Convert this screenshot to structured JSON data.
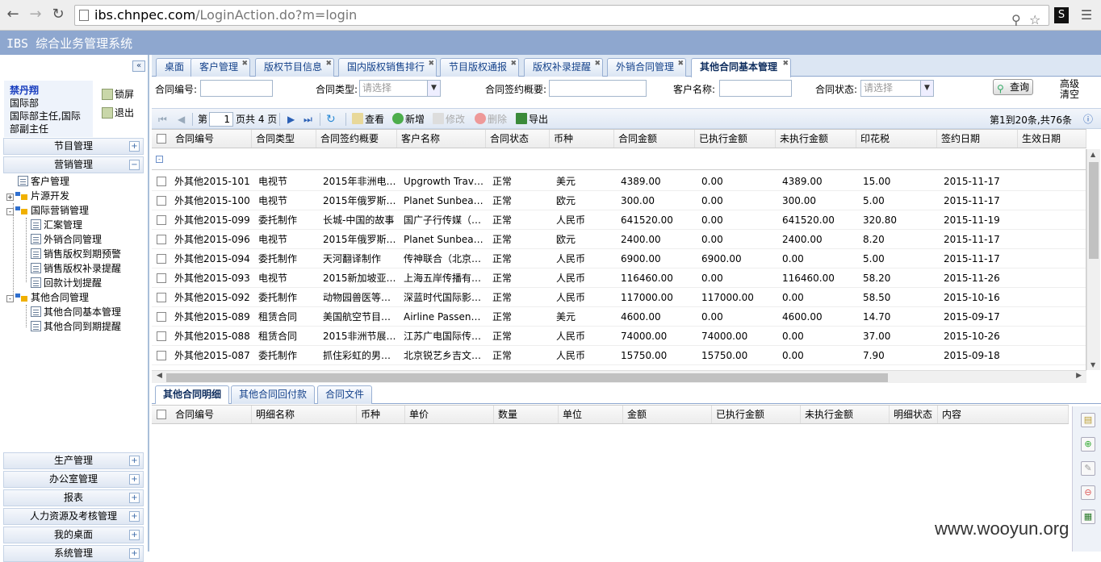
{
  "browser": {
    "url_host": "ibs.chnpec.com",
    "url_path": "/LoginAction.do?m=login",
    "ext_label": "S"
  },
  "app": {
    "title": "IBS 综合业务管理系统"
  },
  "user": {
    "name": "禁丹翔",
    "dept": "国际部",
    "role": "国际部主任,国际",
    "role2": "部副主任",
    "lock_label": "锁屏",
    "logout_label": "退出"
  },
  "sidebar": {
    "sections_top": [
      "节目管理",
      "营销管理"
    ],
    "tree": [
      {
        "label": "客户管理",
        "type": "doc",
        "level": 1
      },
      {
        "label": "片源开发",
        "type": "folder",
        "level": 0
      },
      {
        "label": "国际营销管理",
        "type": "folder",
        "level": 0
      },
      {
        "label": "汇案管理",
        "type": "doc",
        "level": 2
      },
      {
        "label": "外销合同管理",
        "type": "doc",
        "level": 2
      },
      {
        "label": "销售版权到期预警",
        "type": "doc",
        "level": 2
      },
      {
        "label": "销售版权补录提醒",
        "type": "doc",
        "level": 2
      },
      {
        "label": "回款计划提醒",
        "type": "doc",
        "level": 2
      },
      {
        "label": "其他合同管理",
        "type": "folder",
        "level": 0
      },
      {
        "label": "其他合同基本管理",
        "type": "doc",
        "level": 2
      },
      {
        "label": "其他合同到期提醒",
        "type": "doc",
        "level": 2
      }
    ],
    "sections_bottom": [
      "生产管理",
      "办公室管理",
      "报表",
      "人力资源及考核管理",
      "我的桌面",
      "系统管理"
    ]
  },
  "tabs": [
    {
      "label": "桌面",
      "closable": false
    },
    {
      "label": "客户管理",
      "closable": true
    },
    {
      "label": "版权节目信息",
      "closable": true
    },
    {
      "label": "国内版权销售排行",
      "closable": true
    },
    {
      "label": "节目版权通报",
      "closable": true
    },
    {
      "label": "版权补录提醒",
      "closable": true
    },
    {
      "label": "外销合同管理",
      "closable": true
    },
    {
      "label": "其他合同基本管理",
      "closable": true,
      "active": true
    }
  ],
  "search": {
    "contract_no_label": "合同编号:",
    "contract_type_label": "合同类型:",
    "contract_type_value": "请选择",
    "summary_label": "合同签约概要:",
    "customer_label": "客户名称:",
    "status_label": "合同状态:",
    "status_value": "请选择",
    "query_label": "查询",
    "advanced_label": "高级",
    "clear_label": "清空"
  },
  "toolbar": {
    "page_prefix": "第",
    "page_value": "1",
    "page_suffix": "页共 4 页",
    "view": "查看",
    "add": "新增",
    "edit": "修改",
    "delete": "删除",
    "export": "导出",
    "page_info": "第1到20条,共76条"
  },
  "grid": {
    "headers": [
      "合同编号",
      "合同类型",
      "合同签约概要",
      "客户名称",
      "合同状态",
      "币种",
      "合同金额",
      "已执行金额",
      "未执行金额",
      "印花税",
      "签约日期",
      "生效日期"
    ],
    "rows": [
      [
        "外其他2015-101",
        "电视节",
        "2015年非洲电…",
        "Upgrowth Trave…",
        "正常",
        "美元",
        "4389.00",
        "0.00",
        "4389.00",
        "15.00",
        "2015-11-17",
        ""
      ],
      [
        "外其他2015-100",
        "电视节",
        "2015年俄罗斯…",
        "Planet Sunbea…",
        "正常",
        "欧元",
        "300.00",
        "0.00",
        "300.00",
        "5.00",
        "2015-11-17",
        ""
      ],
      [
        "外其他2015-099",
        "委托制作",
        "长城-中国的故事",
        "国广子行传媒（…",
        "正常",
        "人民币",
        "641520.00",
        "0.00",
        "641520.00",
        "320.80",
        "2015-11-19",
        ""
      ],
      [
        "外其他2015-096",
        "电视节",
        "2015年俄罗斯…",
        "Planet Sunbea…",
        "正常",
        "欧元",
        "2400.00",
        "0.00",
        "2400.00",
        "8.20",
        "2015-11-17",
        ""
      ],
      [
        "外其他2015-094",
        "委托制作",
        "天河翻译制作",
        "传神联合（北京…",
        "正常",
        "人民币",
        "6900.00",
        "6900.00",
        "0.00",
        "5.00",
        "2015-11-17",
        ""
      ],
      [
        "外其他2015-093",
        "电视节",
        "2015新加坡亚…",
        "上海五岸传播有…",
        "正常",
        "人民币",
        "116460.00",
        "0.00",
        "116460.00",
        "58.20",
        "2015-11-26",
        ""
      ],
      [
        "外其他2015-092",
        "委托制作",
        "动物园兽医等…",
        "深蓝时代国际影…",
        "正常",
        "人民币",
        "117000.00",
        "117000.00",
        "0.00",
        "58.50",
        "2015-10-16",
        ""
      ],
      [
        "外其他2015-089",
        "租赁合同",
        "美国航空节目…",
        "Airline Passeng…",
        "正常",
        "美元",
        "4600.00",
        "0.00",
        "4600.00",
        "14.70",
        "2015-09-17",
        ""
      ],
      [
        "外其他2015-088",
        "租赁合同",
        "2015非洲节展…",
        "江苏广电国际传…",
        "正常",
        "人民币",
        "74000.00",
        "74000.00",
        "0.00",
        "37.00",
        "2015-10-26",
        ""
      ],
      [
        "外其他2015-087",
        "委托制作",
        "抓住彩虹的男…",
        "北京锐艺乡吉文…",
        "正常",
        "人民币",
        "15750.00",
        "15750.00",
        "0.00",
        "7.90",
        "2015-09-18",
        ""
      ]
    ]
  },
  "detail": {
    "tabs": [
      "其他合同明细",
      "其他合同回付款",
      "合同文件"
    ],
    "headers": [
      "合同编号",
      "明细名称",
      "币种",
      "单价",
      "数量",
      "单位",
      "金额",
      "已执行金额",
      "未执行金额",
      "明细状态",
      "内容"
    ]
  },
  "watermark": "www.wooyun.org"
}
